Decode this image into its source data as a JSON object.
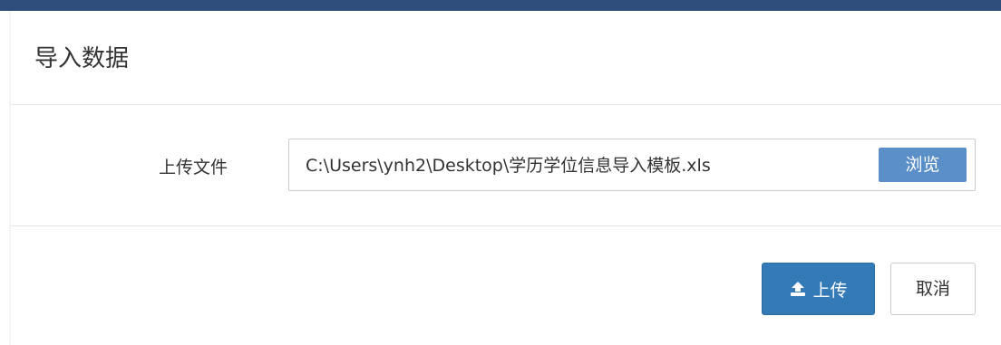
{
  "dialog": {
    "title": "导入数据"
  },
  "form": {
    "upload_label": "上传文件",
    "file_path": "C:\\Users\\ynh2\\Desktop\\学历学位信息导入模板.xls",
    "browse_label": "浏览"
  },
  "footer": {
    "upload_label": "上传",
    "cancel_label": "取消"
  },
  "colors": {
    "primary": "#337ab7",
    "browse": "#5b8fc7",
    "backdrop": "#2f4f7a"
  },
  "icons": {
    "upload": "upload-icon"
  }
}
